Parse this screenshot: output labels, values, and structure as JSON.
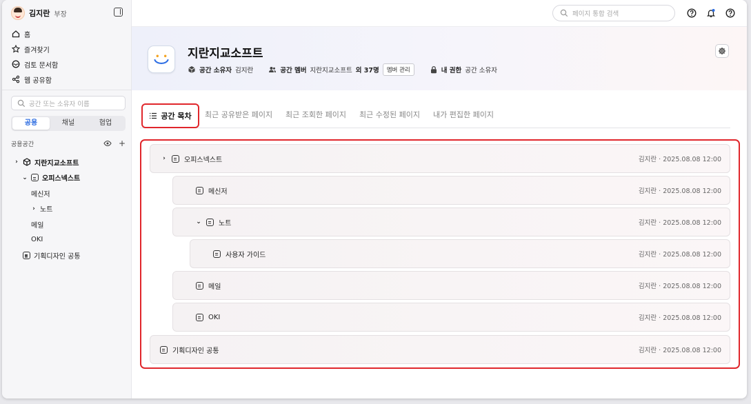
{
  "user": {
    "name": "김지란",
    "role": "부장"
  },
  "nav": [
    {
      "label": "홈",
      "icon": "home-icon"
    },
    {
      "label": "즐겨찾기",
      "icon": "star-icon"
    },
    {
      "label": "검토 문서함",
      "icon": "review-icon"
    },
    {
      "label": "웹 공유함",
      "icon": "share-icon"
    }
  ],
  "sidebar_search": {
    "placeholder": "공간 또는 소유자 이름"
  },
  "segments": [
    "공용",
    "채널",
    "협업"
  ],
  "section": {
    "title": "공용공간"
  },
  "tree": [
    {
      "label": "지란지교소프트",
      "chevron": "›"
    },
    {
      "label": "오피스넥스트",
      "chevron": "⌄"
    },
    {
      "label": "메신저"
    },
    {
      "label": "노트",
      "chevron": "›"
    },
    {
      "label": "메일"
    },
    {
      "label": "OKI"
    },
    {
      "label": "기획디자인 공통"
    }
  ],
  "global_search": {
    "placeholder": "페이지 통합 검색"
  },
  "space": {
    "title": "지란지교소프트",
    "owner_label": "공간 소유자",
    "owner_value": "김지란",
    "member_label": "공간 멤버",
    "member_value": "지란지교소프트",
    "member_count": "외 37명",
    "manage_button": "멤버 관리",
    "permission_label": "내 권한",
    "permission_value": "공간 소유자"
  },
  "tabs": [
    "공간 목차",
    "최근 공유받은 페이지",
    "최근 조회한 페이지",
    "최근 수정된 페이지",
    "내가 편집한 페이지"
  ],
  "toc": [
    {
      "label": "오피스넥스트",
      "info": "김지란 · 2025.08.08 12:00",
      "chevron": "›"
    },
    {
      "label": "메신저",
      "info": "김지란 · 2025.08.08 12:00"
    },
    {
      "label": "노트",
      "info": "김지란 · 2025.08.08 12:00",
      "chevron": "⌄"
    },
    {
      "label": "사용자 가이드",
      "info": "김지란 · 2025.08.08 12:00"
    },
    {
      "label": "메일",
      "info": "김지란 · 2025.08.08 12:00"
    },
    {
      "label": "OKI",
      "info": "김지란 · 2025.08.08 12:00"
    },
    {
      "label": "기획디자인 공통",
      "info": "김지란 · 2025.08.08 12:00"
    }
  ]
}
